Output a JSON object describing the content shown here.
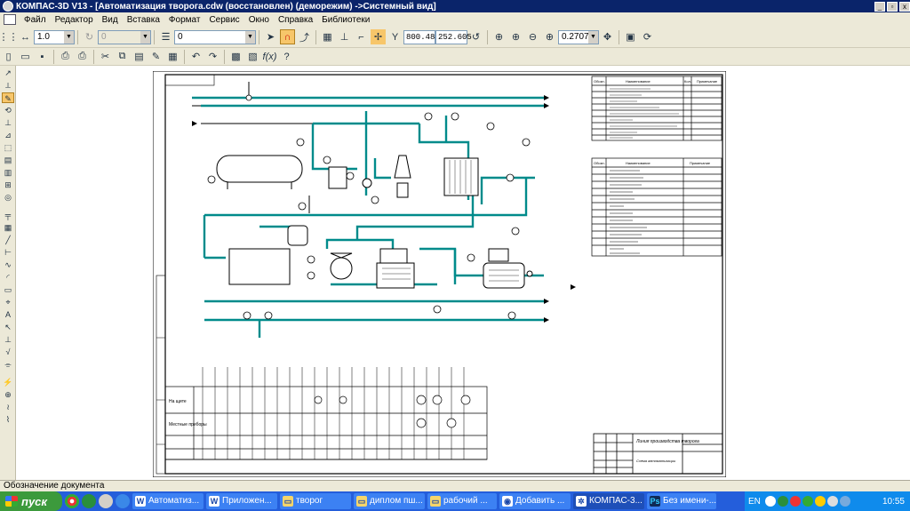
{
  "window": {
    "title": "КОМПАС-3D V13 - [Автоматизация творога.cdw (восстановлен) (деморежим) ->Системный вид]",
    "buttons": [
      "_",
      "▫",
      "x"
    ]
  },
  "menu": [
    "Файл",
    "Редактор",
    "Вид",
    "Вставка",
    "Формат",
    "Сервис",
    "Окно",
    "Справка",
    "Библиотеки"
  ],
  "toolbar": {
    "scale_value": "1.0",
    "step_value": "0",
    "layer_value": "0",
    "coord_x": "800.484",
    "coord_y": "252.605",
    "zoom_value": "0.2707"
  },
  "drawing": {
    "spec_header_1": [
      "Обозн.",
      "Наименование",
      "Кол.",
      "Примечание"
    ],
    "spec_header_2": [
      "Обозн.",
      "Наименование",
      "Примечание"
    ],
    "stamp_title": "Линия производства творога",
    "stamp_subtitle": "Схема автоматизации",
    "row_labels": [
      "На щите",
      "Местные приборы"
    ]
  },
  "status": {
    "text": "Обозначение документа"
  },
  "taskbar": {
    "start_label": "пуск",
    "buttons": [
      {
        "label": "Автоматиз...",
        "icon": "W",
        "active": false
      },
      {
        "label": "Приложен...",
        "icon": "W",
        "active": false
      },
      {
        "label": "творог",
        "icon": "▭",
        "active": false
      },
      {
        "label": "диплом пш...",
        "icon": "▭",
        "active": false
      },
      {
        "label": "рабочий ...",
        "icon": "▭",
        "active": false
      },
      {
        "label": "Добавить ...",
        "icon": "◉",
        "active": false
      },
      {
        "label": "КОМПАС-3...",
        "icon": "✲",
        "active": true
      },
      {
        "label": "Без имени-...",
        "icon": "Ps",
        "active": false
      }
    ],
    "lang": "EN",
    "clock": "10:55"
  },
  "colors": {
    "pipe": "#008b8b",
    "line": "#000000",
    "titlebar": "#0a246a",
    "taskbar": "#245edb"
  }
}
